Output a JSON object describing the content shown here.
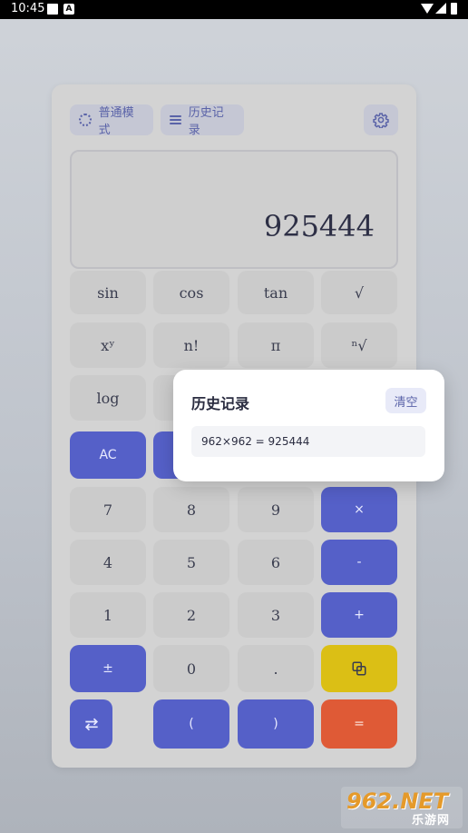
{
  "status_bar": {
    "time": "10:45",
    "notif_icon": "A"
  },
  "toolbar": {
    "mode_label": "普通模式",
    "history_label": "历史记录",
    "settings_icon": "gear-icon"
  },
  "display": {
    "value": "925444"
  },
  "keys": {
    "sin": "sin",
    "cos": "cos",
    "tan": "tan",
    "sqrt": "√",
    "pow": "xʸ",
    "fact": "n!",
    "pi": "π",
    "nroot": "ⁿ√",
    "log": "log",
    "ac": "AC",
    "k7": "7",
    "k8": "8",
    "k9": "9",
    "mul": "×",
    "k4": "4",
    "k5": "5",
    "k6": "6",
    "sub": "-",
    "k1": "1",
    "k2": "2",
    "k3": "3",
    "add": "+",
    "sign": "±",
    "k0": "0",
    "dot": ".",
    "lparen": "(",
    "rparen": ")",
    "eq": "="
  },
  "history_popup": {
    "title": "历史记录",
    "clear_label": "清空",
    "items": [
      "962×962 = 925444"
    ]
  },
  "watermark": {
    "logo": "962.NET",
    "sub": "乐游网"
  },
  "colors": {
    "accent_blue": "#5560c8",
    "accent_yellow": "#dbbf15",
    "accent_red": "#df5a36"
  }
}
